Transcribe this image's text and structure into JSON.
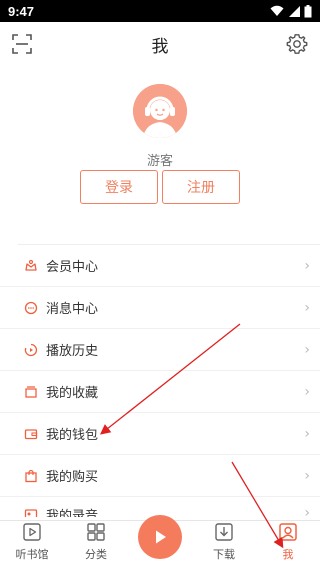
{
  "status": {
    "time": "9:47"
  },
  "header": {
    "title": "我"
  },
  "profile": {
    "username": "游客",
    "login_label": "登录",
    "register_label": "注册"
  },
  "menu": {
    "items": [
      {
        "label": "会员中心",
        "icon": "vip-crown-icon"
      },
      {
        "label": "消息中心",
        "icon": "message-icon"
      },
      {
        "label": "播放历史",
        "icon": "history-icon"
      },
      {
        "label": "我的收藏",
        "icon": "favorites-icon"
      },
      {
        "label": "我的钱包",
        "icon": "wallet-icon"
      },
      {
        "label": "我的购买",
        "icon": "purchase-bag-icon"
      },
      {
        "label": "我的录音",
        "icon": "recording-icon"
      }
    ]
  },
  "tabbar": {
    "tabs": [
      {
        "label": "听书馆",
        "icon": "audiobook-icon"
      },
      {
        "label": "分类",
        "icon": "category-grid-icon"
      },
      {
        "label": "",
        "icon": "play-icon"
      },
      {
        "label": "下载",
        "icon": "download-icon"
      },
      {
        "label": "我",
        "icon": "profile-icon"
      }
    ]
  },
  "colors": {
    "accent": "#f06040",
    "annotation_arrow": "#e02020"
  }
}
